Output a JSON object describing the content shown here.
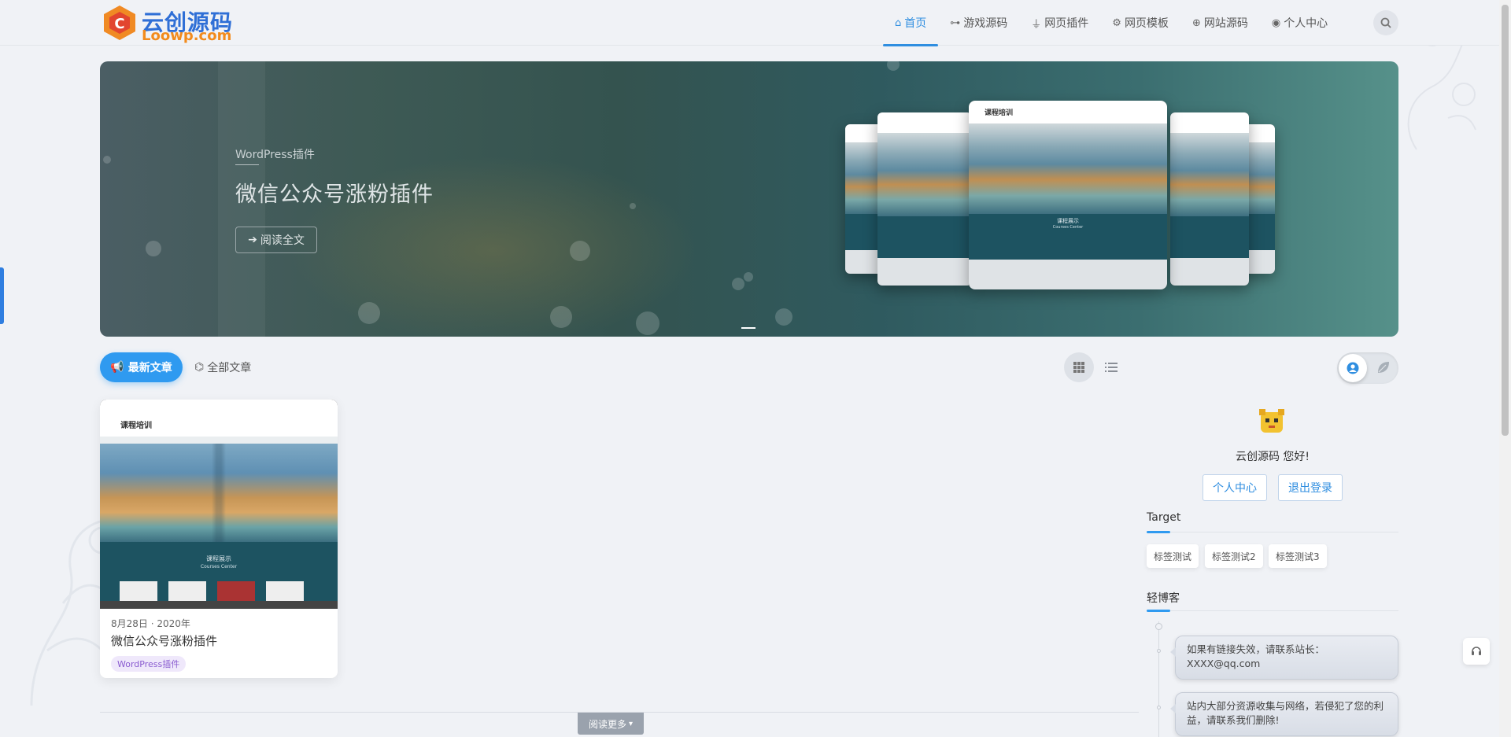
{
  "logo": {
    "cn": "云创源码",
    "en": "Loowp.com"
  },
  "nav": [
    {
      "label": "首页",
      "icon": "home-icon",
      "active": true
    },
    {
      "label": "游戏源码",
      "icon": "gamepad-icon",
      "active": false
    },
    {
      "label": "网页插件",
      "icon": "plug-icon",
      "active": false
    },
    {
      "label": "网页模板",
      "icon": "cogs-icon",
      "active": false
    },
    {
      "label": "网站源码",
      "icon": "globe-icon",
      "active": false
    },
    {
      "label": "个人中心",
      "icon": "user-circle-icon",
      "active": false
    }
  ],
  "hero": {
    "category": "WordPress插件",
    "title": "微信公众号涨粉插件",
    "button": "阅读全文",
    "mock_logo": "课程培训",
    "mock_band_title": "课程展示",
    "mock_band_sub": "Courses Center"
  },
  "tabs": {
    "latest": "最新文章",
    "all": "全部文章"
  },
  "post": {
    "date": "8月28日 · 2020年",
    "title": "微信公众号涨粉插件",
    "tag": "WordPress插件",
    "thumb_logo": "课程培训",
    "thumb_band_title": "课程展示",
    "thumb_band_sub": "Courses Center"
  },
  "sidebar": {
    "greeting": "云创源码 您好!",
    "profile_button": "个人中心",
    "logout_button": "退出登录",
    "tags_title": "Target",
    "tags": [
      "标签测试",
      "标签测试2",
      "标签测试3"
    ],
    "blog_title": "轻博客",
    "blog_items": [
      "如果有链接失效，请联系站长：XXXX@qq.com",
      "站内大部分资源收集与网络，若侵犯了您的利益，请联系我们删除!"
    ]
  },
  "readmore": "阅读更多",
  "colors": {
    "accent": "#2f9af0",
    "nav_active": "#2f8ee0",
    "tag_purple": "#8a5cd0"
  }
}
